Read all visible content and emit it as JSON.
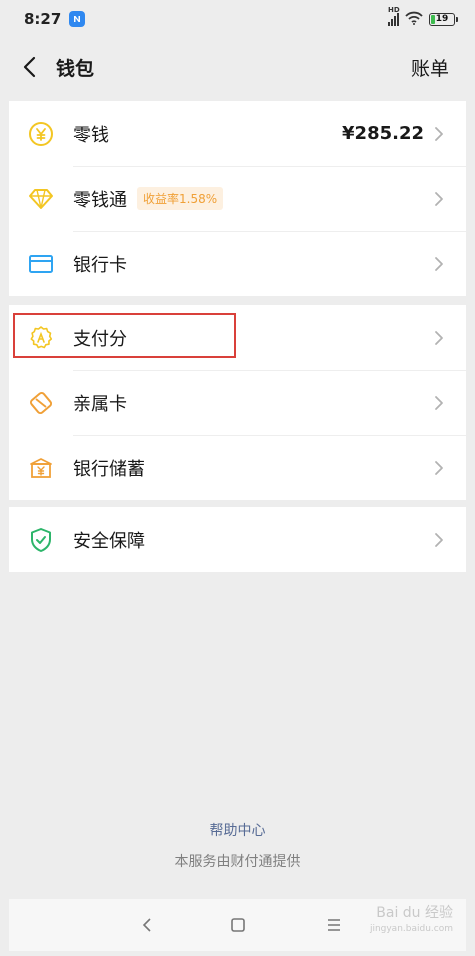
{
  "status_bar": {
    "time": "8:27",
    "app_badge": "N",
    "network_label": "HD",
    "battery_level": "19"
  },
  "header": {
    "back_icon": "chevron-left-icon",
    "title": "钱包",
    "bill_label": "账单"
  },
  "sections": [
    {
      "items": [
        {
          "label": "零钱",
          "icon": "yuan-coin-icon",
          "value": "¥285.22"
        },
        {
          "label": "零钱通",
          "icon": "diamond-icon",
          "tag": "收益率1.58%"
        },
        {
          "label": "银行卡",
          "icon": "bank-card-icon"
        }
      ]
    },
    {
      "items": [
        {
          "label": "支付分",
          "icon": "pay-score-icon"
        },
        {
          "label": "亲属卡",
          "icon": "family-card-icon"
        },
        {
          "label": "银行储蓄",
          "icon": "bank-deposit-icon"
        }
      ]
    },
    {
      "items": [
        {
          "label": "安全保障",
          "icon": "security-shield-icon"
        }
      ]
    }
  ],
  "footer": {
    "help_label": "帮助中心",
    "provider_text": "本服务由财付通提供"
  },
  "watermark": {
    "text": "Bai du 经验",
    "sub": "jingyan.baidu.com"
  },
  "colors": {
    "accent_yellow": "#f3c623",
    "accent_orange": "#f0a037",
    "card_blue": "#2ea4f2",
    "shield_green": "#2db56a",
    "highlight_red": "#d9403a",
    "link_blue": "#576b95"
  }
}
